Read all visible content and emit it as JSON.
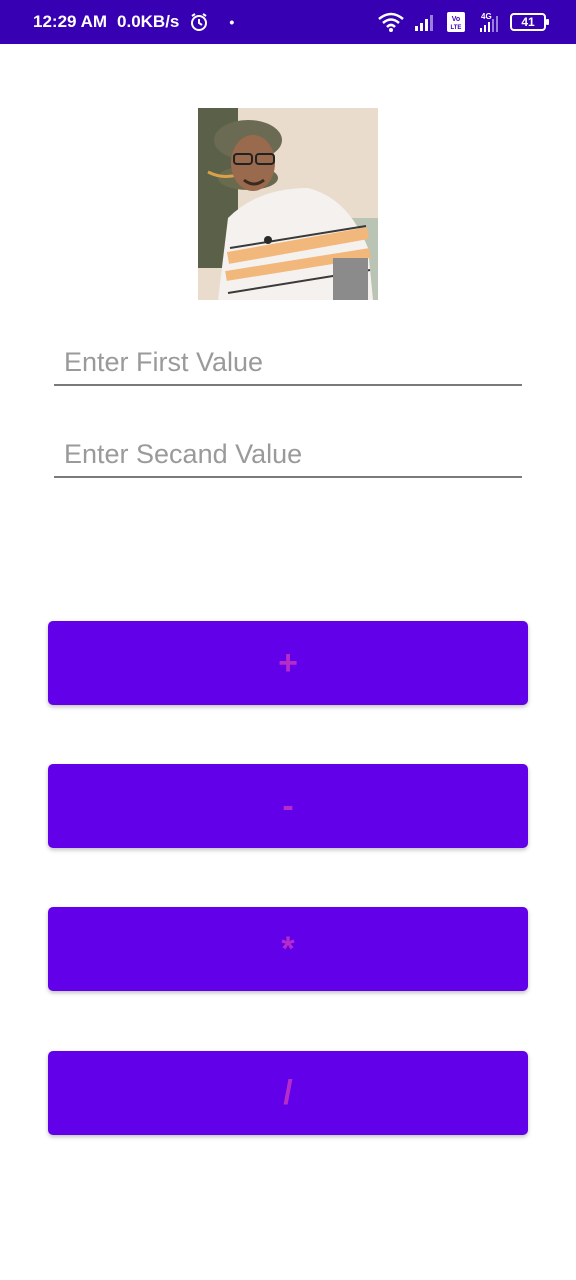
{
  "status_bar": {
    "time": "12:29 AM",
    "speed": "0.0KB/s",
    "network_label": "4G",
    "volte_label": "Vo LTE",
    "battery": "41"
  },
  "inputs": {
    "first_placeholder": "Enter First Value",
    "first_value": "",
    "second_placeholder": "Enter Secand Value",
    "second_value": ""
  },
  "buttons": {
    "add_label": "+",
    "subtract_label": "-",
    "multiply_label": "*",
    "divide_label": "/"
  },
  "colors": {
    "status_bar_bg": "#3700b3",
    "button_bg": "#6200ea",
    "button_text": "#b62cc9"
  }
}
